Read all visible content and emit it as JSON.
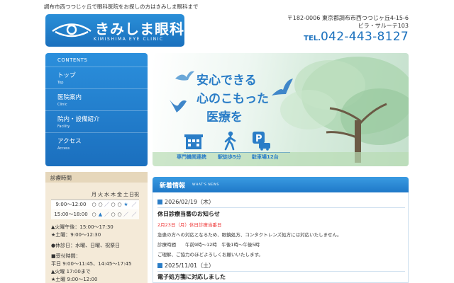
{
  "header": {
    "tagline": "調布市西つつじヶ丘で眼科医院をお探しの方はきみしま眼科まで",
    "logo_name": "きみしま眼科",
    "logo_en": "KIMISHIMA EYE CLINIC",
    "address_line1": "〒182-0006 東京都調布市西つつじヶ丘4-15-6",
    "address_line2": "ビラ・サルーテ103",
    "tel_prefix": "TEL.",
    "tel_number": "042-443-8127"
  },
  "nav": {
    "heading": "CONTENTS",
    "items": [
      {
        "jp": "トップ",
        "en": "Top"
      },
      {
        "jp": "医院案内",
        "en": "Clinic"
      },
      {
        "jp": "院内・設備紹介",
        "en": "Facility"
      },
      {
        "jp": "アクセス",
        "en": "Access"
      }
    ]
  },
  "hero": {
    "line1": "安心できる",
    "line2": "心のこもった",
    "line3": "医療を",
    "cap1": "専門機関連携",
    "cap2": "駅徒歩5分",
    "cap3": "駐車場12台"
  },
  "hours": {
    "title": "診療時間",
    "days": [
      "月",
      "火",
      "水",
      "木",
      "金",
      "土",
      "日祝"
    ],
    "rows": [
      {
        "time": "9:00～12:00",
        "marks": [
          "○",
          "○",
          "／",
          "○",
          "○",
          "★",
          "／"
        ]
      },
      {
        "time": "15:00～18:00",
        "marks": [
          "○",
          "▲",
          "／",
          "○",
          "○",
          "／",
          "／"
        ]
      }
    ],
    "note1": "▲火曜午後：15:00～17:30",
    "note2": "★土曜：9:00～12:30",
    "note3": "●休診日：水曜、日曜、祝祭日",
    "note4": "■受付時間：",
    "note5": "平日 9:00～11:45、14:45～17:45",
    "note6": "▲火曜 17:00まで",
    "note7": "★土曜 9:00～12:00"
  },
  "news": {
    "title": "新着情報",
    "title_en": "WHAT'S NEWS",
    "entries": [
      {
        "date": "2026/02/19（木）",
        "heading": "休日診療当番のお知らせ",
        "highlight": "2月23日（月）休日診療当番日",
        "text1": "急患の方への対応となるため、眼鏡処方、コンタクトレンズ処方には対応いたしません。",
        "text2": "診療時間　　午前9時～12時　午後1時～午後5時",
        "text3": "ご理解、ご協力のほどよろしくお願いいたします。"
      },
      {
        "date": "2025/11/01（土）",
        "heading": "電子処方箋に対応しました"
      }
    ]
  }
}
